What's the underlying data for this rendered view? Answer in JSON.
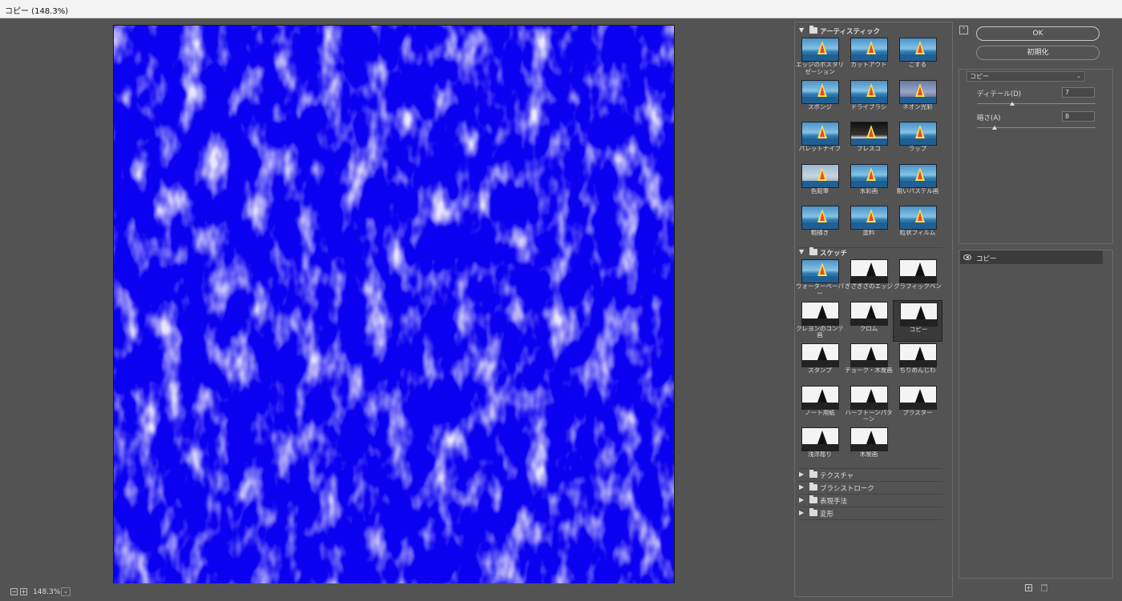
{
  "window": {
    "title": "コピー (148.3%)"
  },
  "status": {
    "zoom": "148.3%"
  },
  "buttons": {
    "ok": "OK",
    "reset": "初期化"
  },
  "settings": {
    "filter_name": "コピー",
    "params": [
      {
        "label": "ディテール(D)",
        "value": "7",
        "level": 0.3
      },
      {
        "label": "暗さ(A)",
        "value": "8",
        "level": 0.15
      }
    ]
  },
  "layers": {
    "items": [
      {
        "label": "コピー"
      }
    ]
  },
  "gallery": {
    "artistic": {
      "label": "アーティスティック",
      "items": [
        {
          "label": "エッジのポスタリゼーション",
          "style": "color"
        },
        {
          "label": "カットアウト",
          "style": "color"
        },
        {
          "label": "こする",
          "style": "color"
        },
        {
          "label": "スポンジ",
          "style": "color"
        },
        {
          "label": "ドライブラシ",
          "style": "color"
        },
        {
          "label": "ネオン光彩",
          "style": "neon"
        },
        {
          "label": "パレットナイフ",
          "style": "color"
        },
        {
          "label": "フレスコ",
          "style": "dark"
        },
        {
          "label": "ラップ",
          "style": "color"
        },
        {
          "label": "色鉛筆",
          "style": "pencil"
        },
        {
          "label": "水彩画",
          "style": "color"
        },
        {
          "label": "粗いパステル画",
          "style": "color"
        },
        {
          "label": "粗描き",
          "style": "color"
        },
        {
          "label": "塗料",
          "style": "color"
        },
        {
          "label": "粒状フィルム",
          "style": "color"
        }
      ]
    },
    "sketch": {
      "label": "スケッチ",
      "items": [
        {
          "label": "ウォーターペーパー",
          "style": "color"
        },
        {
          "label": "ぎざぎざのエッジ",
          "style": "bw"
        },
        {
          "label": "グラフィックペン",
          "style": "bw"
        },
        {
          "label": "クレヨンのコンテ画",
          "style": "bw"
        },
        {
          "label": "クロム",
          "style": "bw"
        },
        {
          "label": "コピー",
          "style": "bw",
          "selected": true
        },
        {
          "label": "スタンプ",
          "style": "bw"
        },
        {
          "label": "チョーク・木炭画",
          "style": "bw"
        },
        {
          "label": "ちりめんじわ",
          "style": "bw"
        },
        {
          "label": "ノート用紙",
          "style": "bw"
        },
        {
          "label": "ハーフトーンパターン",
          "style": "bw"
        },
        {
          "label": "プラスター",
          "style": "bw"
        },
        {
          "label": "浅浮彫り",
          "style": "bw"
        },
        {
          "label": "木炭画",
          "style": "bw"
        }
      ]
    },
    "collapsed": [
      {
        "label": "テクスチャ"
      },
      {
        "label": "ブラシストローク"
      },
      {
        "label": "表現手法"
      },
      {
        "label": "変形"
      }
    ]
  }
}
